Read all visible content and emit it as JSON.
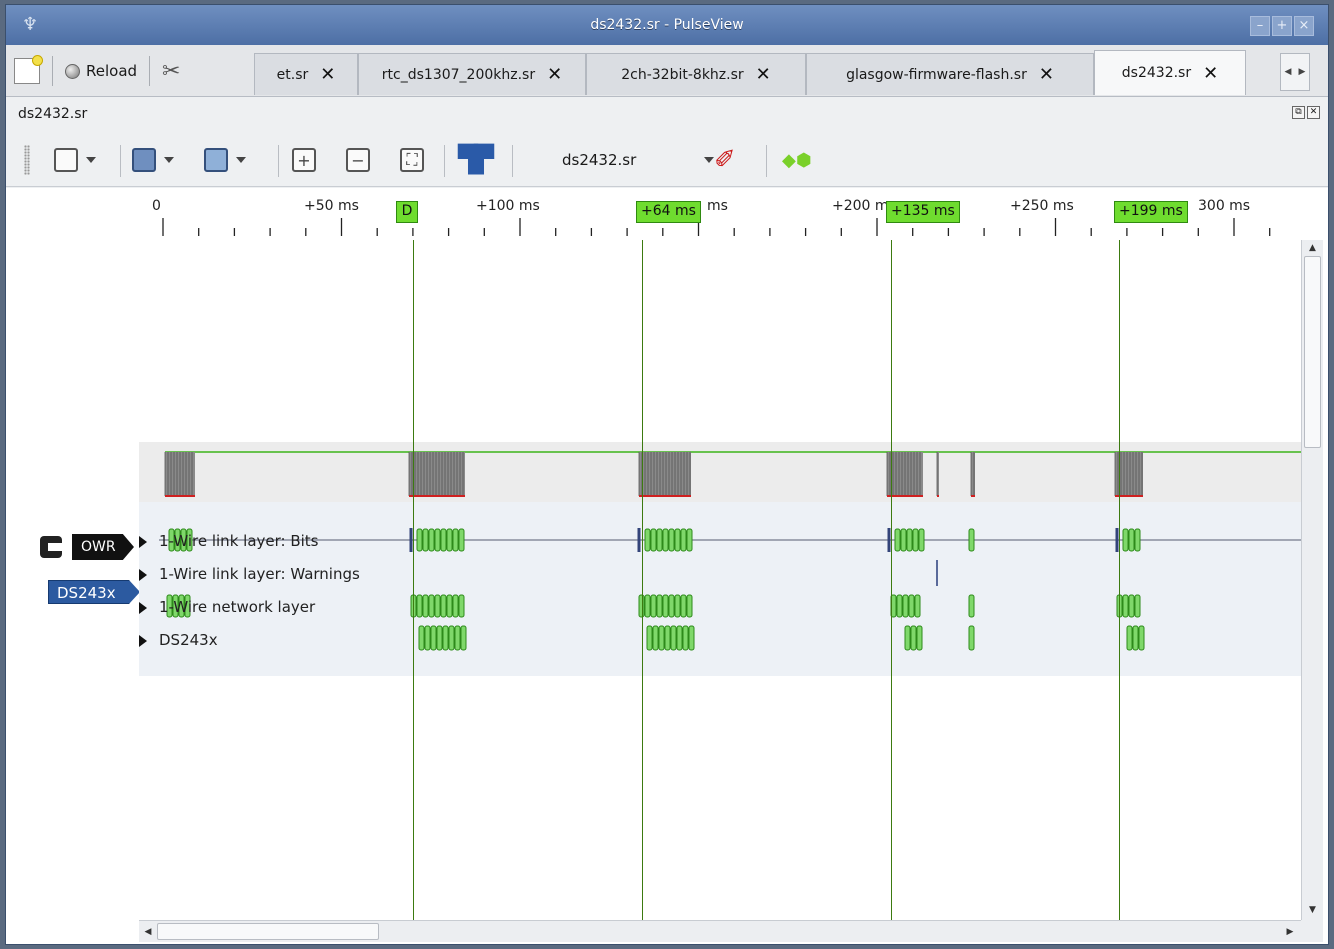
{
  "window": {
    "title": "ds2432.sr - PulseView",
    "app_icon": "pulseview-icon",
    "buttons": [
      "–",
      "+",
      "×"
    ]
  },
  "tabbar": {
    "reload_label": "Reload",
    "tabs": [
      {
        "label": "et.sr",
        "active": false
      },
      {
        "label": "rtc_ds1307_200khz.sr",
        "active": false
      },
      {
        "label": "2ch-32bit-8khz.sr",
        "active": false
      },
      {
        "label": "glasgow-firmware-flash.sr",
        "active": false
      },
      {
        "label": "ds2432.sr",
        "active": true
      }
    ],
    "close_glyph": "✕",
    "scroll_left": "◀",
    "scroll_right": "▶"
  },
  "document": {
    "title": "ds2432.sr",
    "dock_float": "⧉",
    "dock_close": "✕"
  },
  "toolbar": {
    "selected_device": "ds2432.sr"
  },
  "ruler": {
    "ticks": [
      "0",
      "+50 ms",
      "+100 ms",
      "ms",
      "+200 m",
      "+250 ms",
      "300 ms"
    ],
    "cursor_flags": [
      "D",
      "+64 ms",
      "+135 ms",
      "+199 ms"
    ]
  },
  "signals": {
    "owr_label": "OWR",
    "decoder_label": "DS243x",
    "rows": [
      "1-Wire link layer: Bits",
      "1-Wire link layer: Warnings",
      "1-Wire network layer",
      "DS243x"
    ]
  },
  "colors": {
    "accent_green": "#6fdc2f",
    "decoder_blue": "#2c5aa0",
    "trace_green": "#3cb31a"
  }
}
